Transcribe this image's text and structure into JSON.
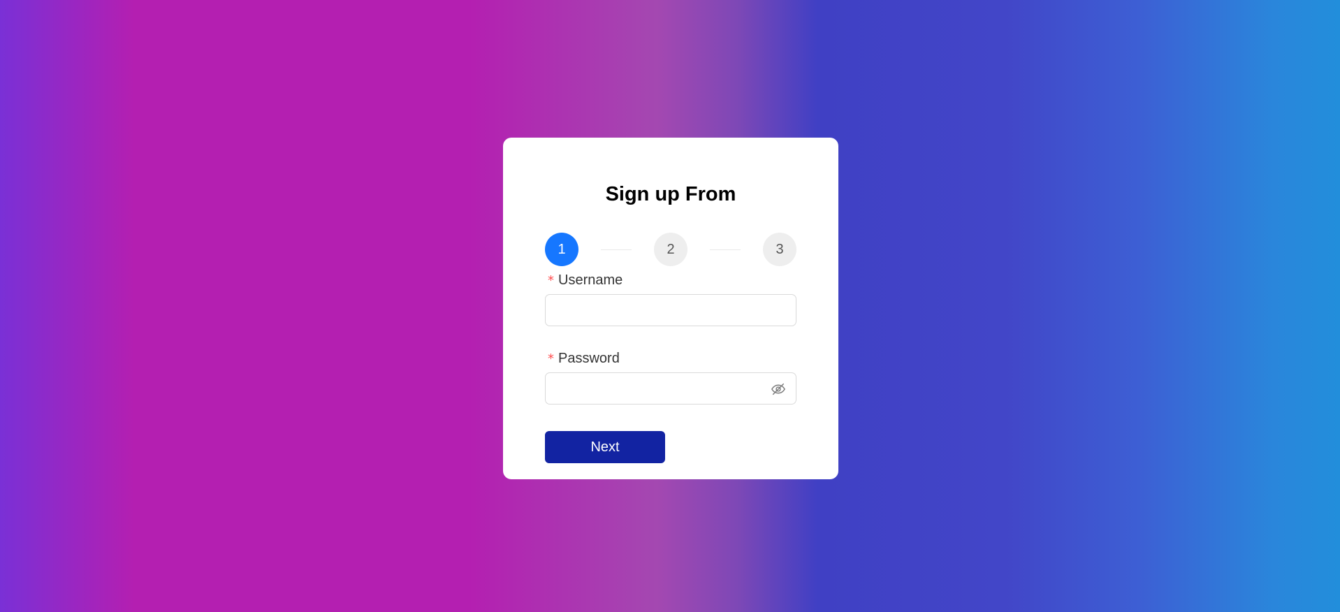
{
  "form": {
    "title": "Sign up From",
    "steps": [
      {
        "label": "1",
        "state": "active"
      },
      {
        "label": "2",
        "state": "pending"
      },
      {
        "label": "3",
        "state": "pending"
      }
    ],
    "fields": {
      "username": {
        "required_mark": "*",
        "label": "Username",
        "value": "",
        "placeholder": ""
      },
      "password": {
        "required_mark": "*",
        "label": "Password",
        "value": "",
        "placeholder": "",
        "toggle_icon": "eye-invisible-icon"
      }
    },
    "next_label": "Next"
  },
  "colors": {
    "active_step": "#1677ff",
    "next_button": "#1223a2",
    "required_mark": "#ff4d4f"
  }
}
